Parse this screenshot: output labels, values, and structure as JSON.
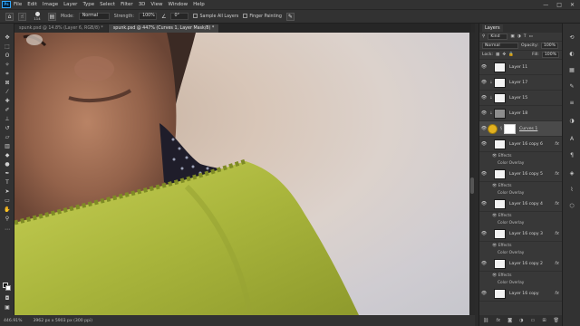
{
  "menubar": {
    "logo": "Ps",
    "items": [
      "File",
      "Edit",
      "Image",
      "Layer",
      "Type",
      "Select",
      "Filter",
      "3D",
      "View",
      "Window",
      "Help"
    ],
    "controls": [
      "—",
      "□",
      "✕"
    ]
  },
  "options": {
    "brush_size": "114",
    "mode_label": "Mode:",
    "mode_value": "Normal",
    "strength_label": "Strength:",
    "strength_value": "100%",
    "angle_value": "0°",
    "sample_all_layers": "Sample All Layers",
    "finger_painting": "Finger Painting"
  },
  "tabs": [
    {
      "label": "spunk.psd @ 14.8% (Layer 6, RGB/8) *",
      "active": false
    },
    {
      "label": "spunk.psd @ 447% (Curves 1, Layer Mask/8) *",
      "active": true
    }
  ],
  "status": {
    "zoom": "446.91%",
    "doc_size": "3962 px x 5903 px (300 ppi)"
  },
  "layers_panel": {
    "title": "Layers",
    "kind_label": "Kind",
    "blend_mode": "Normal",
    "opacity_label": "Opacity:",
    "opacity_value": "100%",
    "lock_label": "Lock:",
    "fill_label": "Fill:",
    "fill_value": "100%",
    "layers": [
      {
        "name": "Layer 11",
        "thumb": "white",
        "linked": false,
        "selected": false,
        "fx": false
      },
      {
        "name": "Layer 17",
        "thumb": "white",
        "linked": true,
        "selected": false,
        "fx": false
      },
      {
        "name": "Layer 15",
        "thumb": "white",
        "linked": true,
        "selected": false,
        "fx": false
      },
      {
        "name": "Layer 18",
        "thumb": "gray",
        "linked": true,
        "selected": false,
        "fx": false
      },
      {
        "name": "Curves 1",
        "thumb": "mask",
        "linked": false,
        "selected": true,
        "fx": false,
        "adjustment": true
      },
      {
        "name": "Layer 16 copy 6",
        "thumb": "white",
        "linked": false,
        "selected": false,
        "fx": true,
        "effects": "Effects",
        "effect": "Color Overlay"
      },
      {
        "name": "Layer 16 copy 5",
        "thumb": "white",
        "linked": false,
        "selected": false,
        "fx": true,
        "effects": "Effects",
        "effect": "Color Overlay"
      },
      {
        "name": "Layer 16 copy 4",
        "thumb": "white",
        "linked": false,
        "selected": false,
        "fx": true,
        "effects": "Effects",
        "effect": "Color Overlay"
      },
      {
        "name": "Layer 16 copy 3",
        "thumb": "white",
        "linked": false,
        "selected": false,
        "fx": true,
        "effects": "Effects",
        "effect": "Color Overlay"
      },
      {
        "name": "Layer 16 copy 2",
        "thumb": "white",
        "linked": false,
        "selected": false,
        "fx": true,
        "effects": "Effects",
        "effect": "Color Overlay"
      },
      {
        "name": "Layer 16 copy",
        "thumb": "white",
        "linked": false,
        "selected": false,
        "fx": true,
        "effects": "Effects",
        "effect": "Color Overlay"
      }
    ],
    "fx_label": "fx",
    "footer_icons": [
      "link-icon",
      "fx-icon",
      "mask-icon",
      "adjustment-icon",
      "folder-icon",
      "new-layer-icon",
      "trash-icon"
    ]
  },
  "colors": {
    "accent": "#31a8ff",
    "blouse": "#a7b43a",
    "skin": "#9b6a4e",
    "background": "#d8cfc9"
  }
}
